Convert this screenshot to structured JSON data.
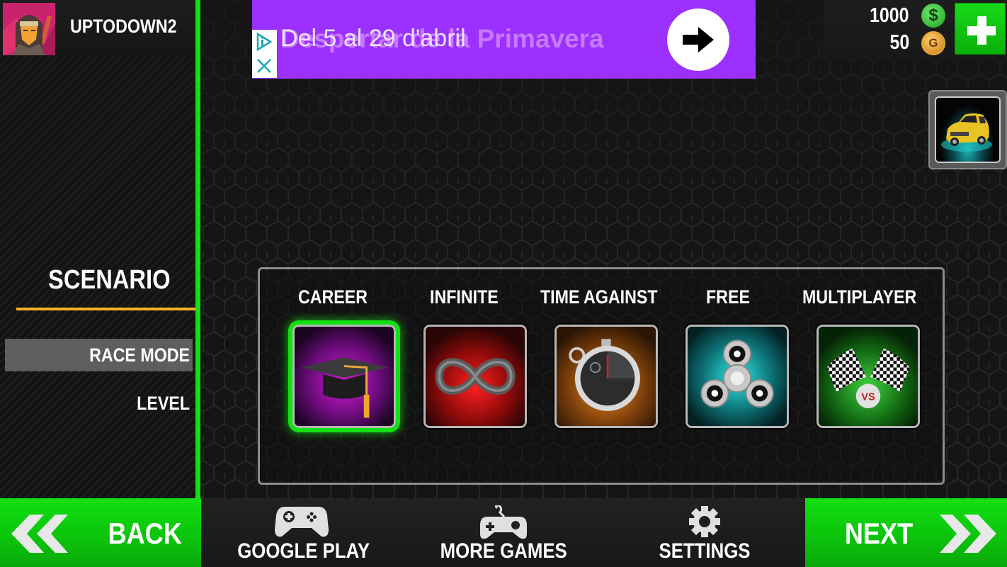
{
  "player": {
    "username": "UPTODOWN2",
    "avatar_icon": "archer-avatar-icon"
  },
  "currency": {
    "cash": "1000",
    "cash_icon": "dollar-coin-icon",
    "gold": "50",
    "gold_icon": "gold-coin-icon",
    "gold_symbol": "G",
    "cash_symbol": "$",
    "add_icon": "plus-icon"
  },
  "ad": {
    "headline": "Del 5 al 29 d'abril",
    "background_text": "Despertar de la Primavera",
    "arrow_icon": "arrow-right-icon",
    "adchoices_icon": "adchoices-icon",
    "close_icon": "close-icon",
    "color": "#9b30ff"
  },
  "sidebar": {
    "section_title": "SCENARIO",
    "items": [
      {
        "label": "RACE MODE",
        "active": true
      },
      {
        "label": "LEVEL",
        "active": false
      }
    ],
    "accent": "#f4b327",
    "rail_color": "#10e010"
  },
  "vehicle": {
    "icon": "yellow-car-icon"
  },
  "race_modes": [
    {
      "label": "CAREER",
      "icon": "graduation-cap-icon",
      "selected": true
    },
    {
      "label": "INFINITE",
      "icon": "infinity-icon",
      "selected": false
    },
    {
      "label": "TIME AGAINST",
      "icon": "stopwatch-icon",
      "selected": false
    },
    {
      "label": "FREE",
      "icon": "fidget-spinner-icon",
      "selected": false
    },
    {
      "label": "MULTIPLAYER",
      "icon": "checkered-flags-vs-icon",
      "selected": false
    }
  ],
  "bottom_bar": {
    "back": "BACK",
    "next": "NEXT",
    "google_play": "GOOGLE PLAY",
    "more_games": "MORE GAMES",
    "settings": "SETTINGS",
    "accent": "#11e011"
  }
}
